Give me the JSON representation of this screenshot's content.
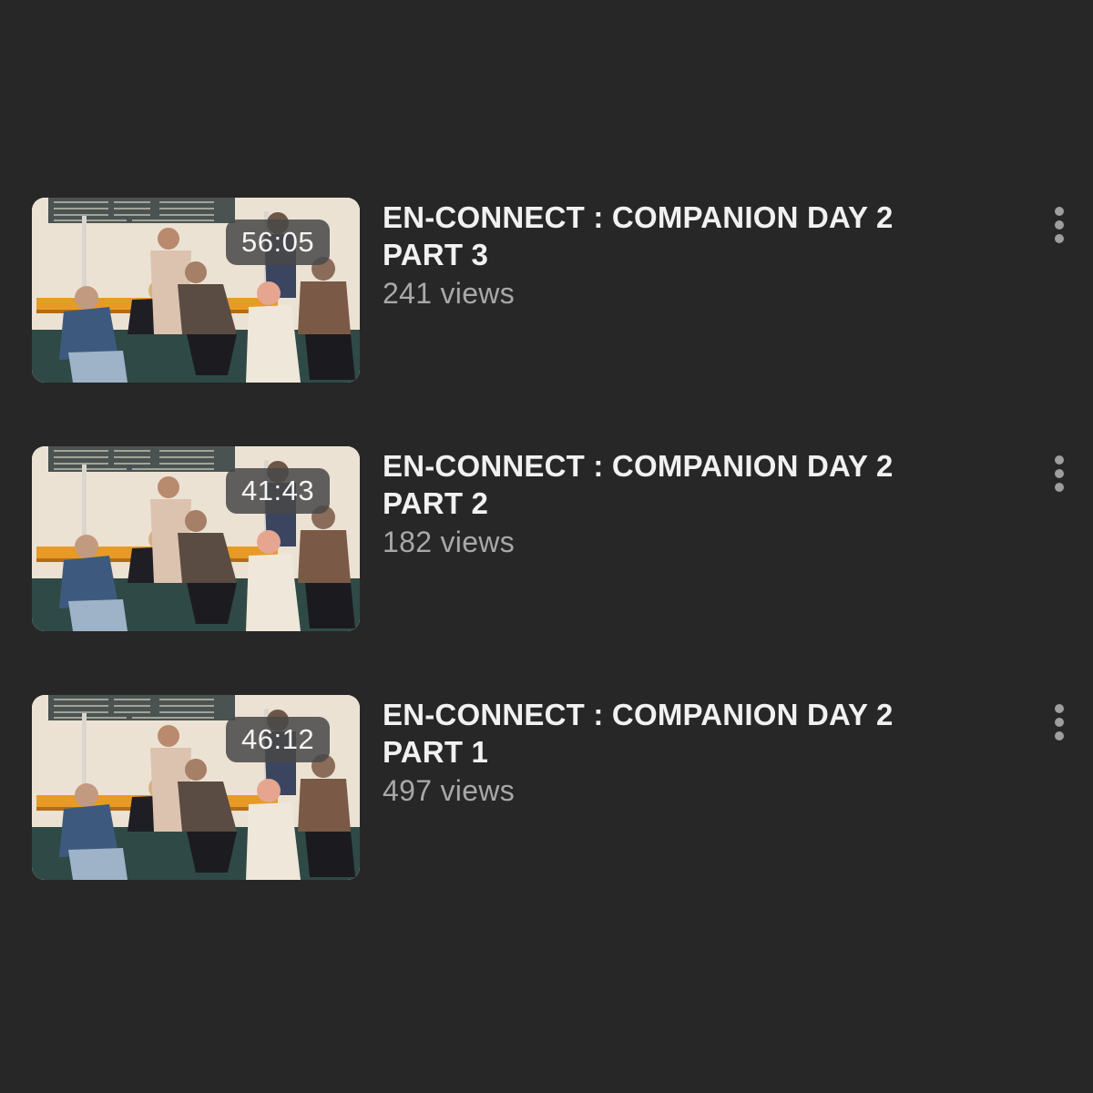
{
  "videos": [
    {
      "title_line1": "EN-CONNECT : COMPANION DAY 2",
      "title_line2": "PART 3",
      "views": "241 views",
      "duration": "56:05"
    },
    {
      "title_line1": "EN-CONNECT : COMPANION DAY 2",
      "title_line2": "PART 2",
      "views": "182 views",
      "duration": "41:43"
    },
    {
      "title_line1": "EN-CONNECT : COMPANION DAY 2",
      "title_line2": "PART 1",
      "views": "497 views",
      "duration": "46:12"
    }
  ],
  "icons": {
    "more": "more-vertical-icon"
  },
  "colors": {
    "background": "#272727",
    "title": "#f1f1f1",
    "meta": "#a8a8a8",
    "duration_badge": "#484848"
  }
}
